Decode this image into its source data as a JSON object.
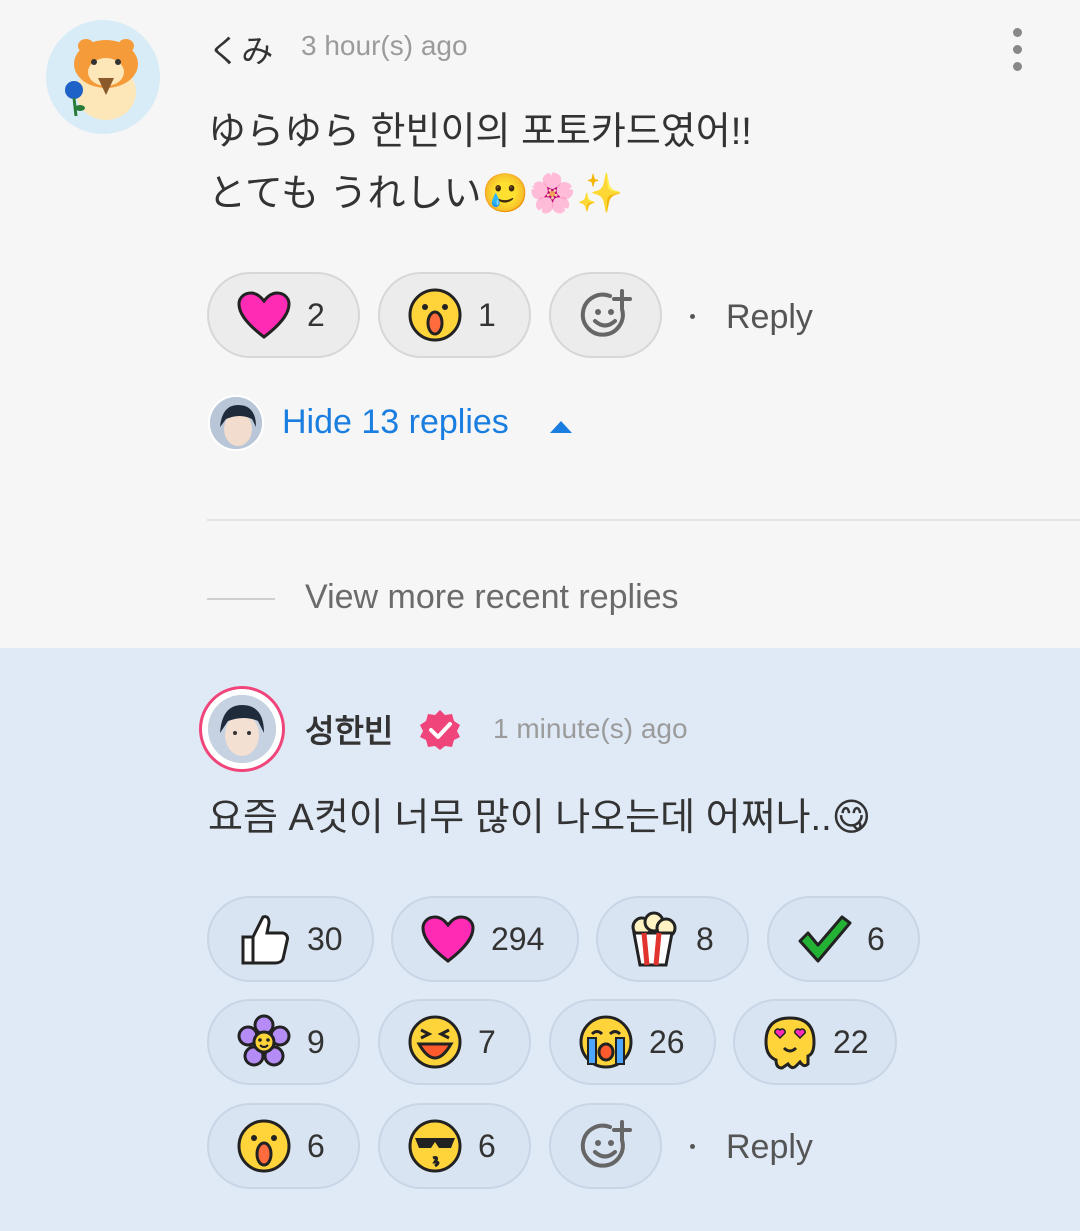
{
  "comment1": {
    "username": "くみ",
    "time": "3 hour(s) ago",
    "line1": "ゆらゆら 한빈이의 포토카드였어!!",
    "line2": "とても うれしい🥲🌸✨",
    "reactions": [
      {
        "icon": "heart-icon",
        "count": "2"
      },
      {
        "icon": "surprised-face-icon",
        "count": "1"
      }
    ],
    "reply_label": "Reply",
    "hide_replies": "Hide 13 replies",
    "view_more": "View more recent replies"
  },
  "comment2": {
    "username": "성한빈",
    "time": "1 minute(s) ago",
    "text": "요즘 A컷이 너무 많이 나오는데 어쩌나..😋",
    "reactions": [
      {
        "icon": "thumbs-up-icon",
        "count": "30"
      },
      {
        "icon": "heart-icon",
        "count": "294"
      },
      {
        "icon": "popcorn-icon",
        "count": "8"
      },
      {
        "icon": "check-mark-icon",
        "count": "6"
      },
      {
        "icon": "flower-icon",
        "count": "9"
      },
      {
        "icon": "laughing-face-icon",
        "count": "7"
      },
      {
        "icon": "crying-face-icon",
        "count": "26"
      },
      {
        "icon": "heart-eyes-melting-icon",
        "count": "22"
      },
      {
        "icon": "surprised-face-icon",
        "count": "6"
      },
      {
        "icon": "sunglasses-kiss-icon",
        "count": "6"
      }
    ],
    "reply_label": "Reply"
  },
  "colors": {
    "link_blue": "#1a7ee0",
    "verified_pink": "#f0457b",
    "heart_pink": "#ff2bb5",
    "highlight_bg": "#e0eaf7"
  }
}
